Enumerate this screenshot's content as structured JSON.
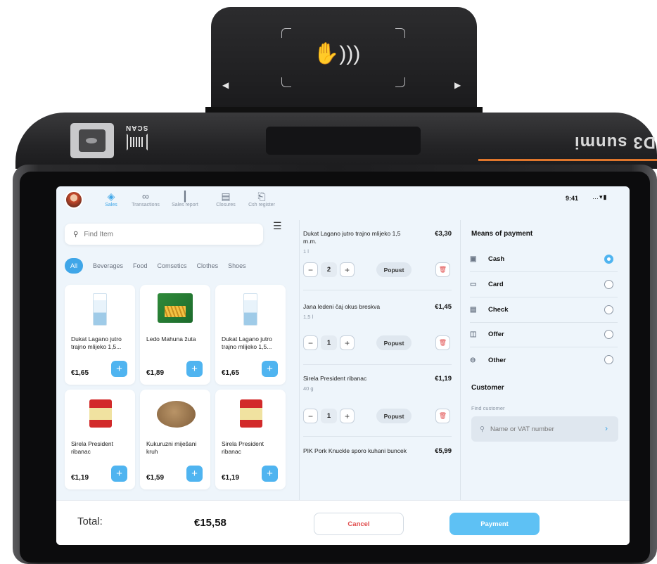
{
  "device": {
    "scan_label": "SCAN",
    "brand": "D3 sunmi"
  },
  "status": {
    "time": "9:41",
    "signal": "…▾▮"
  },
  "nav": [
    {
      "label": "Sales",
      "icon": "tag-icon",
      "glyph": "◈"
    },
    {
      "label": "Transactions",
      "icon": "link-icon",
      "glyph": "∞"
    },
    {
      "label": "Sales report",
      "icon": "bar-chart-icon",
      "glyph": "┃"
    },
    {
      "label": "Closures",
      "icon": "clipboard-icon",
      "glyph": "▤"
    },
    {
      "label": "Csh register",
      "icon": "cash-register-icon",
      "glyph": "⎗"
    }
  ],
  "search": {
    "placeholder": "Find Item"
  },
  "categories": [
    "All",
    "Beverages",
    "Food",
    "Comsetics",
    "Clothes",
    "Shoes"
  ],
  "products": [
    {
      "name": "Dukat Lagano jutro trajno mlijeko 1,5...",
      "price": "€1,65",
      "image": "milk"
    },
    {
      "name": "Ledo Mahuna žuta",
      "price": "€1,89",
      "image": "fries"
    },
    {
      "name": "Dukat Lagano jutro trajno mlijeko 1,5...",
      "price": "€1,65",
      "image": "milk"
    },
    {
      "name": "Sirela President ribanac",
      "price": "€1,19",
      "image": "cheese"
    },
    {
      "name": "Kukuruzni miješani kruh",
      "price": "€1,59",
      "image": "bread"
    },
    {
      "name": "Sirela President ribanac",
      "price": "€1,19",
      "image": "cheese"
    }
  ],
  "add_label": "+",
  "order": [
    {
      "name": "Dukat Lagano jutro trajno mlijeko 1,5 m.m.",
      "sub": "1 l",
      "price": "€3,30",
      "qty": "2"
    },
    {
      "name": "Jana ledeni čaj okus breskva",
      "sub": "1,5 l",
      "price": "€1,45",
      "qty": "1"
    },
    {
      "name": "Sirela President ribanac",
      "sub": "40 g",
      "price": "€1,19",
      "qty": "1"
    },
    {
      "name": "PIK Pork Knuckle sporo kuhani buncek",
      "sub": "",
      "price": "€5,99",
      "qty": ""
    }
  ],
  "order_controls": {
    "minus": "−",
    "plus": "+",
    "discount": "Popust",
    "delete_glyph": "🗑"
  },
  "payment": {
    "title": "Means of payment",
    "methods": [
      {
        "label": "Cash",
        "icon": "cash-icon",
        "glyph": "▣",
        "selected": true
      },
      {
        "label": "Card",
        "icon": "card-icon",
        "glyph": "▭",
        "selected": false
      },
      {
        "label": "Check",
        "icon": "check-icon",
        "glyph": "▤",
        "selected": false
      },
      {
        "label": "Offer",
        "icon": "document-icon",
        "glyph": "◫",
        "selected": false
      },
      {
        "label": "Other",
        "icon": "circle-minus-icon",
        "glyph": "⊖",
        "selected": false
      }
    ]
  },
  "customer": {
    "title": "Customer",
    "label": "Find customer",
    "placeholder": "Name or VAT number"
  },
  "footer": {
    "total_label": "Total:",
    "total_value": "€15,58",
    "cancel": "Cancel",
    "payment": "Payment"
  },
  "colors": {
    "accent": "#3fa6e8",
    "danger": "#e04b4b",
    "payment_button": "#5ec1f4"
  }
}
